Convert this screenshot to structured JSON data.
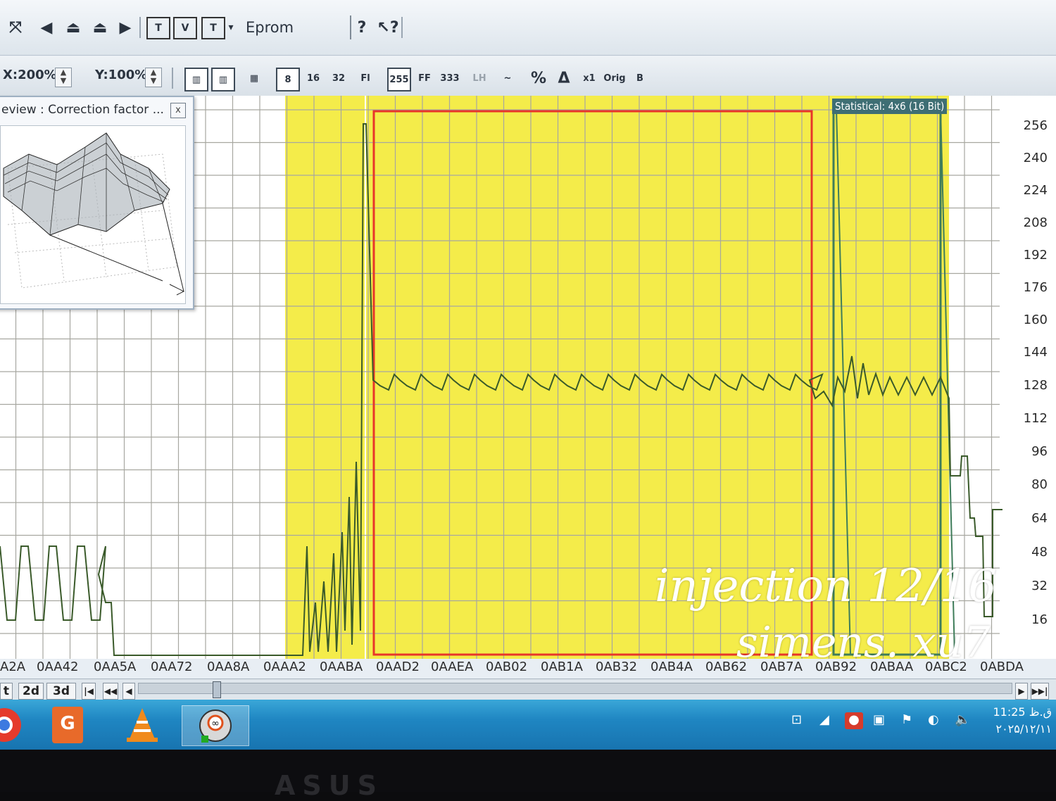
{
  "toolbar1": {
    "icons": [
      "cursor-icon",
      "arrow-left-icon",
      "upload-icon",
      "download-icon",
      "arrow-right-icon",
      "map-text-icon",
      "map-2d-icon",
      "map-3d-icon",
      "dropdown-icon",
      "help-icon",
      "context-help-icon"
    ],
    "eprom_label": "Eprom"
  },
  "toolbar2": {
    "x_zoom": "X:200%",
    "y_zoom": "Y:100%"
  },
  "preview": {
    "title": "eview : Correction factor ...",
    "close": "x"
  },
  "statistical_label": "Statistical: 4x6 (16 Bit)",
  "y_axis_labels": [
    "256",
    "240",
    "224",
    "208",
    "192",
    "176",
    "160",
    "144",
    "128",
    "112",
    "96",
    "80",
    "64",
    "48",
    "32",
    "16"
  ],
  "x_axis_labels": [
    "A2A",
    "0AA42",
    "0AA5A",
    "0AA72",
    "0AA8A",
    "0AAA2",
    "0AABA",
    "0AAD2",
    "0AAEA",
    "0AB02",
    "0AB1A",
    "0AB32",
    "0AB4A",
    "0AB62",
    "0AB7A",
    "0AB92",
    "0ABAA",
    "0ABC2",
    "0ABDA"
  ],
  "view_tabs": [
    "t",
    "2d",
    "3d"
  ],
  "colors": {
    "highlight_yellow": "#f3ea36",
    "selection_red": "#e8352a",
    "stat_border_green": "#3f7d5a",
    "trace": "#3a5a2a",
    "taskbar_blue": "#2187c4"
  },
  "taskbar": {
    "apps": [
      "chrome-icon",
      "pdf-icon",
      "vlc-icon",
      "winols-icon"
    ],
    "time": "11:25 ق.ظ",
    "date": "۲۰۲۵/۱۲/۱۱"
  },
  "overlay": {
    "line1": "injection 12/16",
    "line2": "simens. xu7"
  },
  "bezel_brand": "ASUS"
}
